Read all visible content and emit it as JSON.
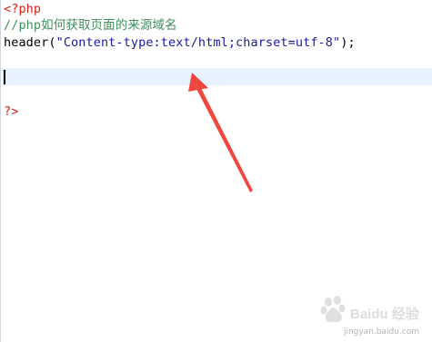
{
  "code": {
    "line1": "<?php",
    "line2": "//php如何获取页面的来源域名",
    "line3": {
      "func": "header(",
      "string": "\"Content-type:text/html;charset=utf-8\"",
      "end": ");"
    },
    "line6": "?>"
  },
  "watermark": {
    "brand": "Baidu 经验",
    "url": "jingyan.baidu.com"
  },
  "colors": {
    "tag": "#d3241a",
    "comment": "#3f8f5a",
    "string": "#1a1aa6",
    "arrow": "#f0473f",
    "current_line": "#e8f2fe"
  }
}
